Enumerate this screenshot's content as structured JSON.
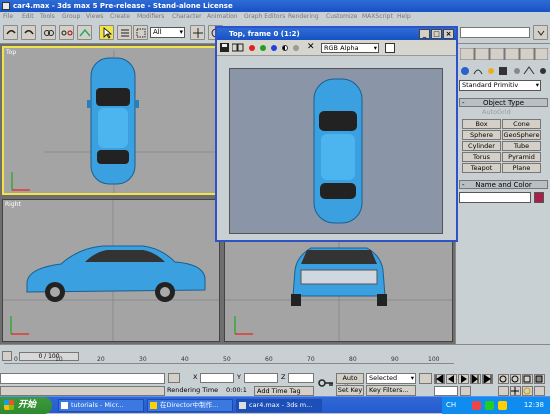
{
  "app": {
    "title": "car4.max - 3ds max 5 Pre-release - Stand-alone License",
    "menu": [
      "File",
      "Edit",
      "Tools",
      "Group",
      "Views",
      "Create",
      "Modifiers",
      "Character",
      "Animation",
      "Graph Editors",
      "Rendering",
      "Customize",
      "MAXScript",
      "Help"
    ]
  },
  "toolbar": {
    "selection_filter": "All"
  },
  "viewports": {
    "top_label": "Top",
    "right_label": "Right"
  },
  "frame_window": {
    "title": "Top, frame 0 (1:2)",
    "channel": "RGB Alpha"
  },
  "command_panel": {
    "category": "Standard Primitiv",
    "object_type_label": "Object Type",
    "autogrid": "AutoGrid",
    "buttons": [
      "Box",
      "Cone",
      "Sphere",
      "GeoSphere",
      "Cylinder",
      "Tube",
      "Torus",
      "Pyramid",
      "Teapot",
      "Plane"
    ],
    "name_color_label": "Name and Color",
    "object_color": "#a7204c"
  },
  "timeline": {
    "slider_text": "0 / 100",
    "ticks": [
      "0",
      "10",
      "20",
      "30",
      "40",
      "50",
      "60",
      "70",
      "80",
      "90",
      "100"
    ]
  },
  "status": {
    "rendering_time_label": "Rendering Time",
    "rendering_time_value": "0:00:1",
    "add_time_tag": "Add Time Tag",
    "x_label": "X",
    "y_label": "Y",
    "z_label": "Z",
    "auto_key": "Auto Key",
    "set_key": "Set Key",
    "key_mode": "Selected",
    "key_filters": "Key Filters..."
  },
  "taskbar": {
    "start": "开始",
    "tasks": [
      "tutorials - Micr...",
      "在Director中制作...",
      "car4.max - 3ds m..."
    ],
    "ime": "CH",
    "clock": "12:38"
  }
}
